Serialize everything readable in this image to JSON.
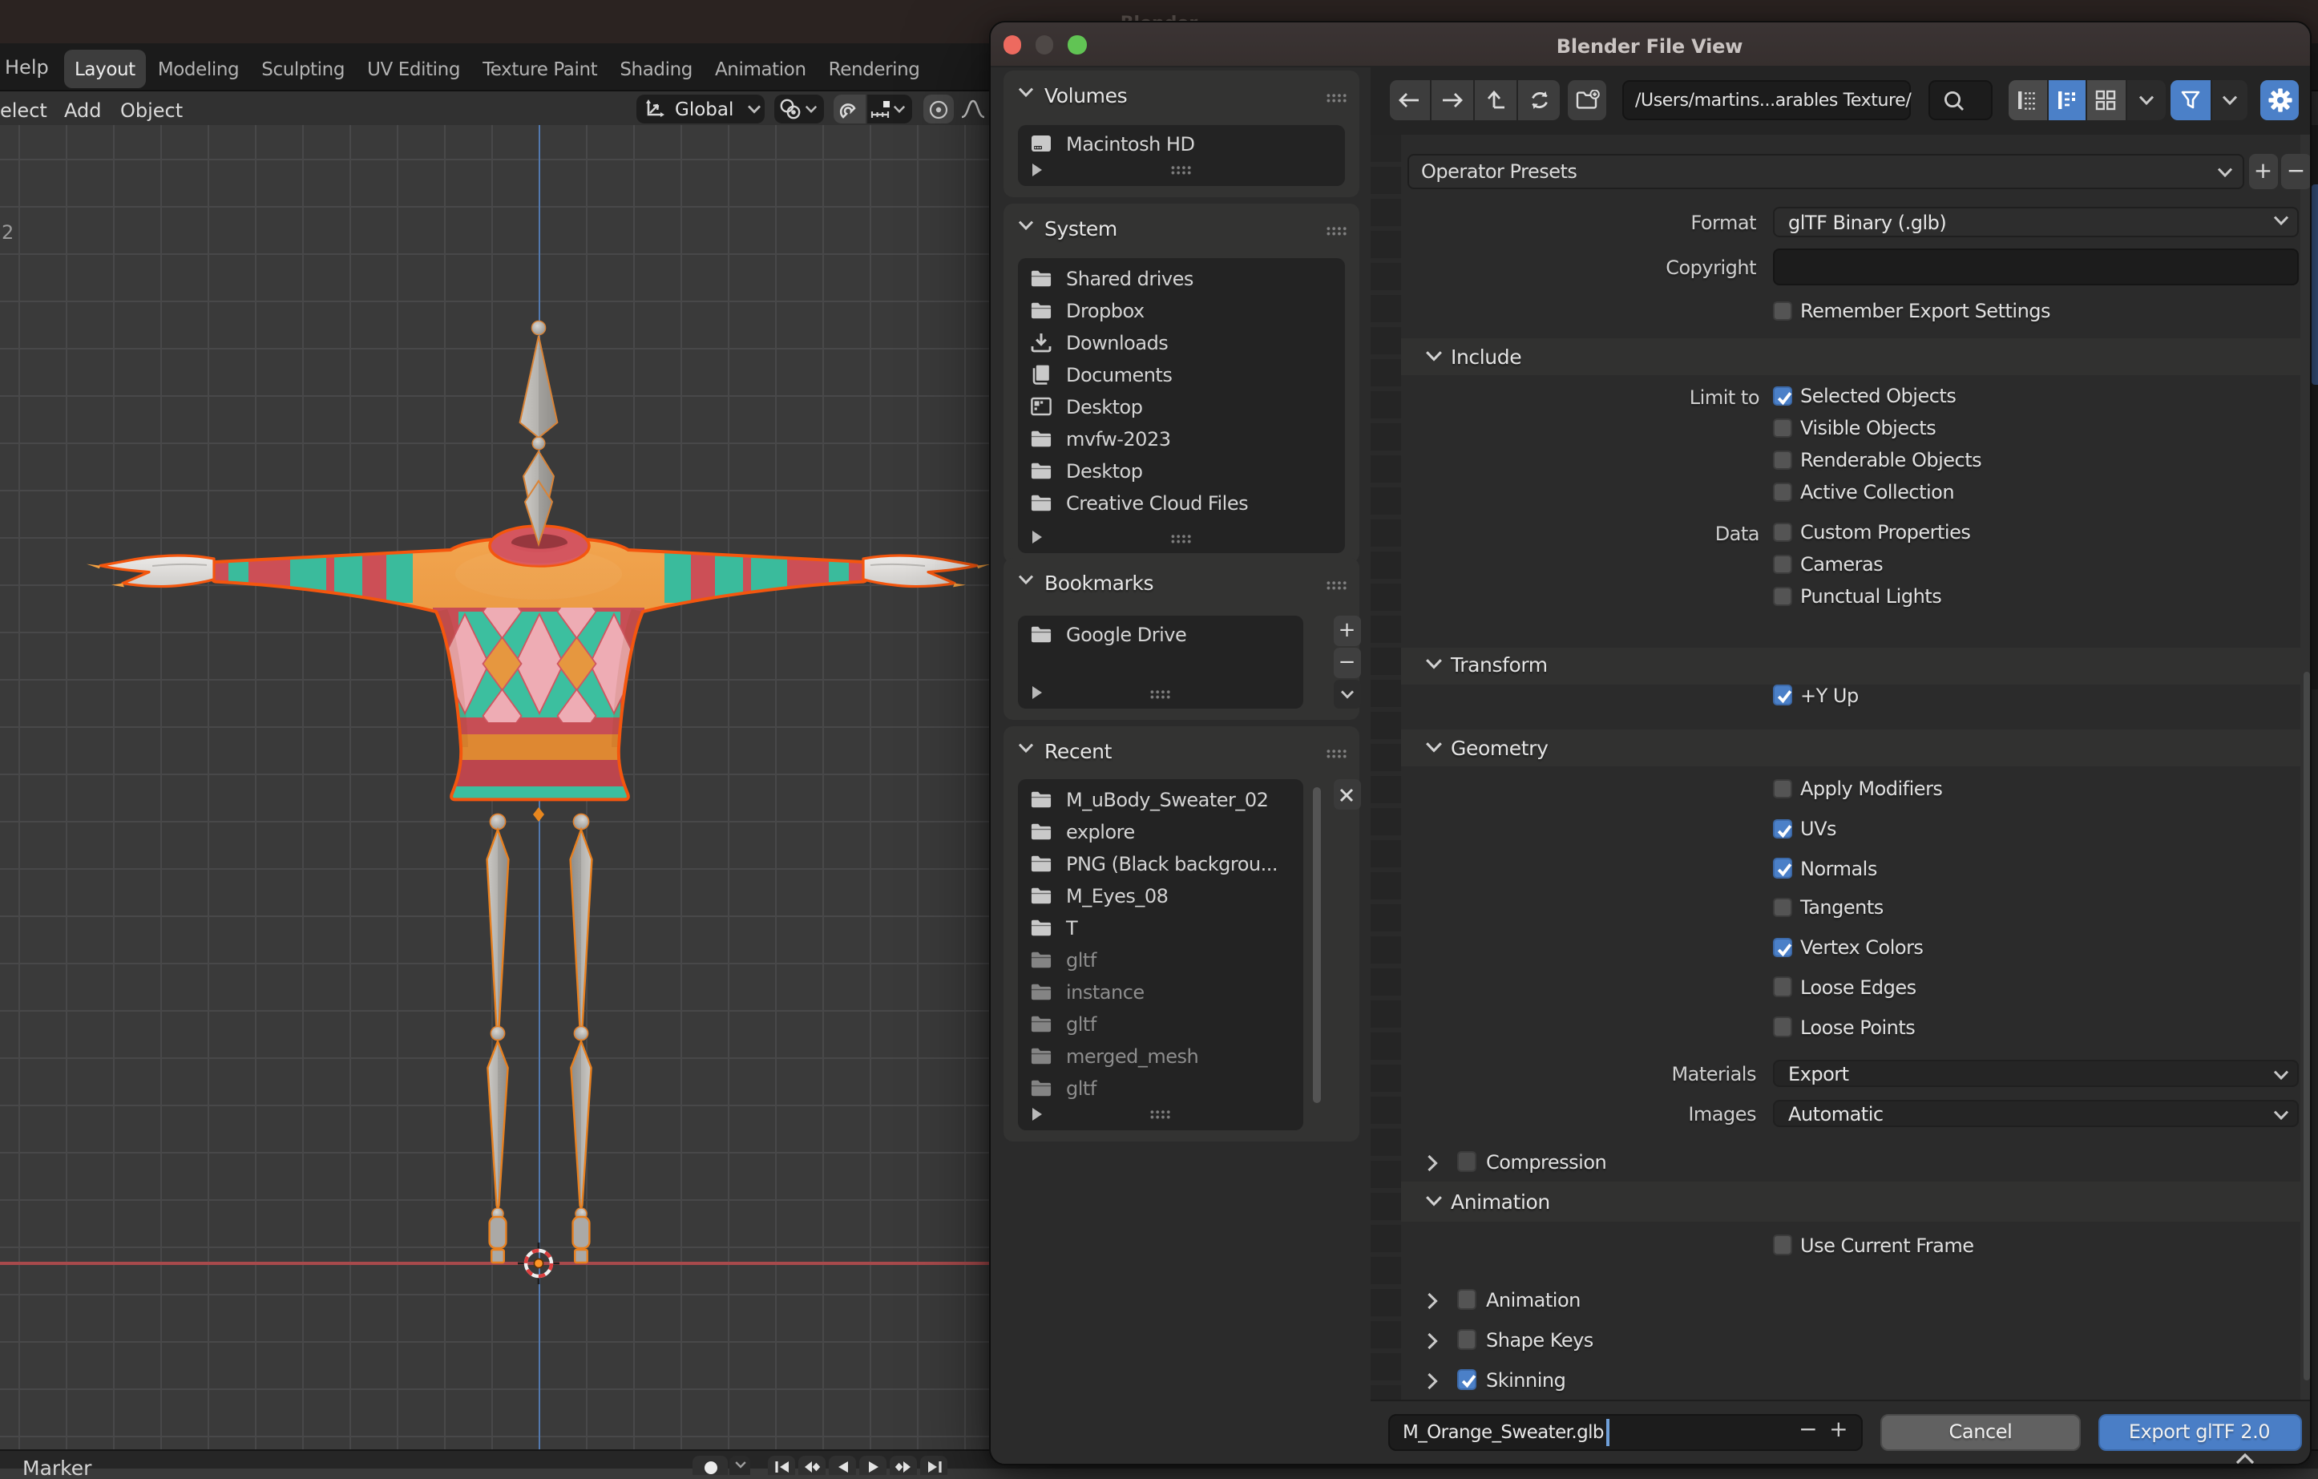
{
  "app": {
    "window_title": "Blender",
    "menu_help": "Help",
    "tabs": [
      {
        "label": "Layout",
        "active": true
      },
      {
        "label": "Modeling"
      },
      {
        "label": "Sculpting"
      },
      {
        "label": "UV Editing"
      },
      {
        "label": "Texture Paint"
      },
      {
        "label": "Shading"
      },
      {
        "label": "Animation"
      },
      {
        "label": "Rendering"
      }
    ],
    "viewport_menus": [
      {
        "label": "elect"
      },
      {
        "label": "Add"
      },
      {
        "label": "Object"
      }
    ],
    "orientation_value": "Global",
    "viewport_overlay_label": "2",
    "timeline_label": "Marker"
  },
  "dialog": {
    "title": "Blender File View",
    "sidebar": {
      "volumes": {
        "title": "Volumes",
        "items": [
          {
            "label": "Macintosh HD",
            "icon": "drive-icon"
          }
        ]
      },
      "system": {
        "title": "System",
        "items": [
          {
            "label": "Shared drives",
            "icon": "folder-icon"
          },
          {
            "label": "Dropbox",
            "icon": "folder-icon"
          },
          {
            "label": "Downloads",
            "icon": "download-icon"
          },
          {
            "label": "Documents",
            "icon": "documents-icon"
          },
          {
            "label": "Desktop",
            "icon": "desktop-icon"
          },
          {
            "label": "mvfw-2023",
            "icon": "folder-icon"
          },
          {
            "label": "Desktop",
            "icon": "folder-icon"
          },
          {
            "label": "Creative Cloud Files",
            "icon": "folder-icon"
          }
        ]
      },
      "bookmarks": {
        "title": "Bookmarks",
        "items": [
          {
            "label": "Google Drive",
            "icon": "folder-icon"
          }
        ],
        "add_label": "+",
        "remove_label": "−"
      },
      "recent": {
        "title": "Recent",
        "items": [
          {
            "label": "M_uBody_Sweater_02"
          },
          {
            "label": "explore"
          },
          {
            "label": "PNG (Black backgrou..."
          },
          {
            "label": "M_Eyes_08"
          },
          {
            "label": "T"
          },
          {
            "label": "gltf",
            "dim": true
          },
          {
            "label": "instance",
            "dim": true
          },
          {
            "label": "gltf",
            "dim": true
          },
          {
            "label": "merged_mesh",
            "dim": true
          },
          {
            "label": "gltf",
            "dim": true
          }
        ]
      }
    },
    "toolbar": {
      "path_value": "/Users/martins...arables Texture/"
    },
    "presets_label": "Operator Presets",
    "fields": {
      "format_label": "Format",
      "format_value": "glTF Binary (.glb)",
      "copyright_label": "Copyright",
      "remember_label": "Remember Export Settings"
    },
    "include_section": {
      "title": "Include",
      "limit_rows": [
        {
          "prefix": "Limit to",
          "label": "Selected Objects",
          "checked": true
        },
        {
          "prefix": "",
          "label": "Visible Objects"
        },
        {
          "prefix": "",
          "label": "Renderable Objects"
        },
        {
          "prefix": "",
          "label": "Active Collection"
        }
      ],
      "data_rows": [
        {
          "prefix": "Data",
          "label": "Custom Properties"
        },
        {
          "prefix": "",
          "label": "Cameras"
        },
        {
          "prefix": "",
          "label": "Punctual Lights"
        }
      ]
    },
    "transform_section": {
      "title": "Transform",
      "rows": [
        {
          "prefix": "",
          "label": "+Y Up",
          "checked": true
        }
      ]
    },
    "geometry_section": {
      "title": "Geometry",
      "rows": [
        {
          "prefix": "",
          "label": "Apply Modifiers"
        },
        {
          "prefix": "",
          "label": "UVs",
          "checked": true
        },
        {
          "prefix": "",
          "label": "Normals",
          "checked": true
        },
        {
          "prefix": "",
          "label": "Tangents"
        },
        {
          "prefix": "",
          "label": "Vertex Colors",
          "checked": true
        },
        {
          "prefix": "",
          "label": "Loose Edges"
        },
        {
          "prefix": "",
          "label": "Loose Points"
        }
      ],
      "materials_label": "Materials",
      "materials_value": "Export",
      "images_label": "Images",
      "images_value": "Automatic"
    },
    "compression_row": {
      "label": "Compression"
    },
    "animation_section": {
      "title": "Animation",
      "rows": [
        {
          "prefix": "",
          "label": "Use Current Frame"
        }
      ],
      "collapsed_rows": [
        {
          "label": "Animation"
        },
        {
          "label": "Shape Keys"
        },
        {
          "label": "Skinning",
          "checked": true
        }
      ]
    },
    "footer": {
      "filename_value": "M_Orange_Sweater.glb",
      "decrement_label": "−",
      "increment_label": "+",
      "cancel_label": "Cancel",
      "export_label": "Export glTF 2.0"
    }
  },
  "colors": {
    "accent_blue": "#4b80c8",
    "selected_outline_orange": "#f4560e",
    "sweater_orange": "#e8963f",
    "sweater_teal": "#3abb9c",
    "sweater_red": "#cc4f56",
    "traffic_red": "#ed6a5f",
    "traffic_green": "#61c454"
  }
}
